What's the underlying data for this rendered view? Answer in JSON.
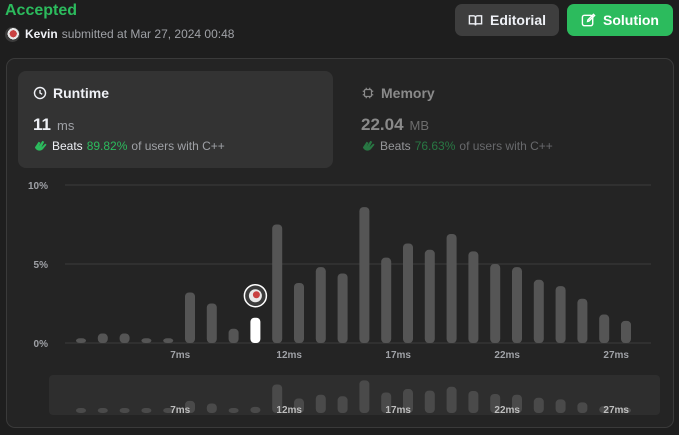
{
  "header": {
    "status": "Accepted",
    "user": "Kevin",
    "submitted_text": "submitted at Mar 27, 2024 00:48",
    "editorial_label": "Editorial",
    "solution_label": "Solution"
  },
  "runtime": {
    "label": "Runtime",
    "value": "11",
    "unit": "ms",
    "beats_word": "Beats",
    "beats_pct": "89.82%",
    "beats_suffix": "of users with C++"
  },
  "memory": {
    "label": "Memory",
    "value": "22.04",
    "unit": "MB",
    "beats_word": "Beats",
    "beats_pct": "76.63%",
    "beats_suffix": "of users with C++"
  },
  "colors": {
    "accent_green": "#2cbb5d",
    "bar": "#555555",
    "highlight_bar": "#ffffff",
    "panel_bg": "#242424"
  },
  "chart_data": {
    "type": "bar",
    "x_unit": "ms",
    "categories": [
      3,
      4,
      5,
      6,
      7,
      8,
      9,
      10,
      11,
      12,
      13,
      14,
      15,
      16,
      17,
      18,
      19,
      20,
      21,
      22,
      23,
      24,
      25,
      26,
      27
    ],
    "values": [
      0.3,
      0.6,
      0.6,
      0.3,
      0.3,
      3.2,
      2.5,
      0.9,
      1.6,
      7.5,
      3.8,
      4.8,
      4.4,
      8.6,
      5.4,
      6.3,
      5.9,
      6.9,
      5.8,
      5.0,
      4.8,
      4.0,
      3.6,
      2.8,
      1.8,
      1.4
    ],
    "highlight_category": 11,
    "y_ticks": [
      "0%",
      "5%",
      "10%"
    ],
    "y_tick_values": [
      0,
      5,
      10
    ],
    "ylim": [
      0,
      10
    ],
    "x_tick_labels": [
      "7ms",
      "12ms",
      "17ms",
      "22ms",
      "27ms"
    ],
    "x_tick_values": [
      7,
      12,
      17,
      22,
      27
    ],
    "grid": true
  }
}
